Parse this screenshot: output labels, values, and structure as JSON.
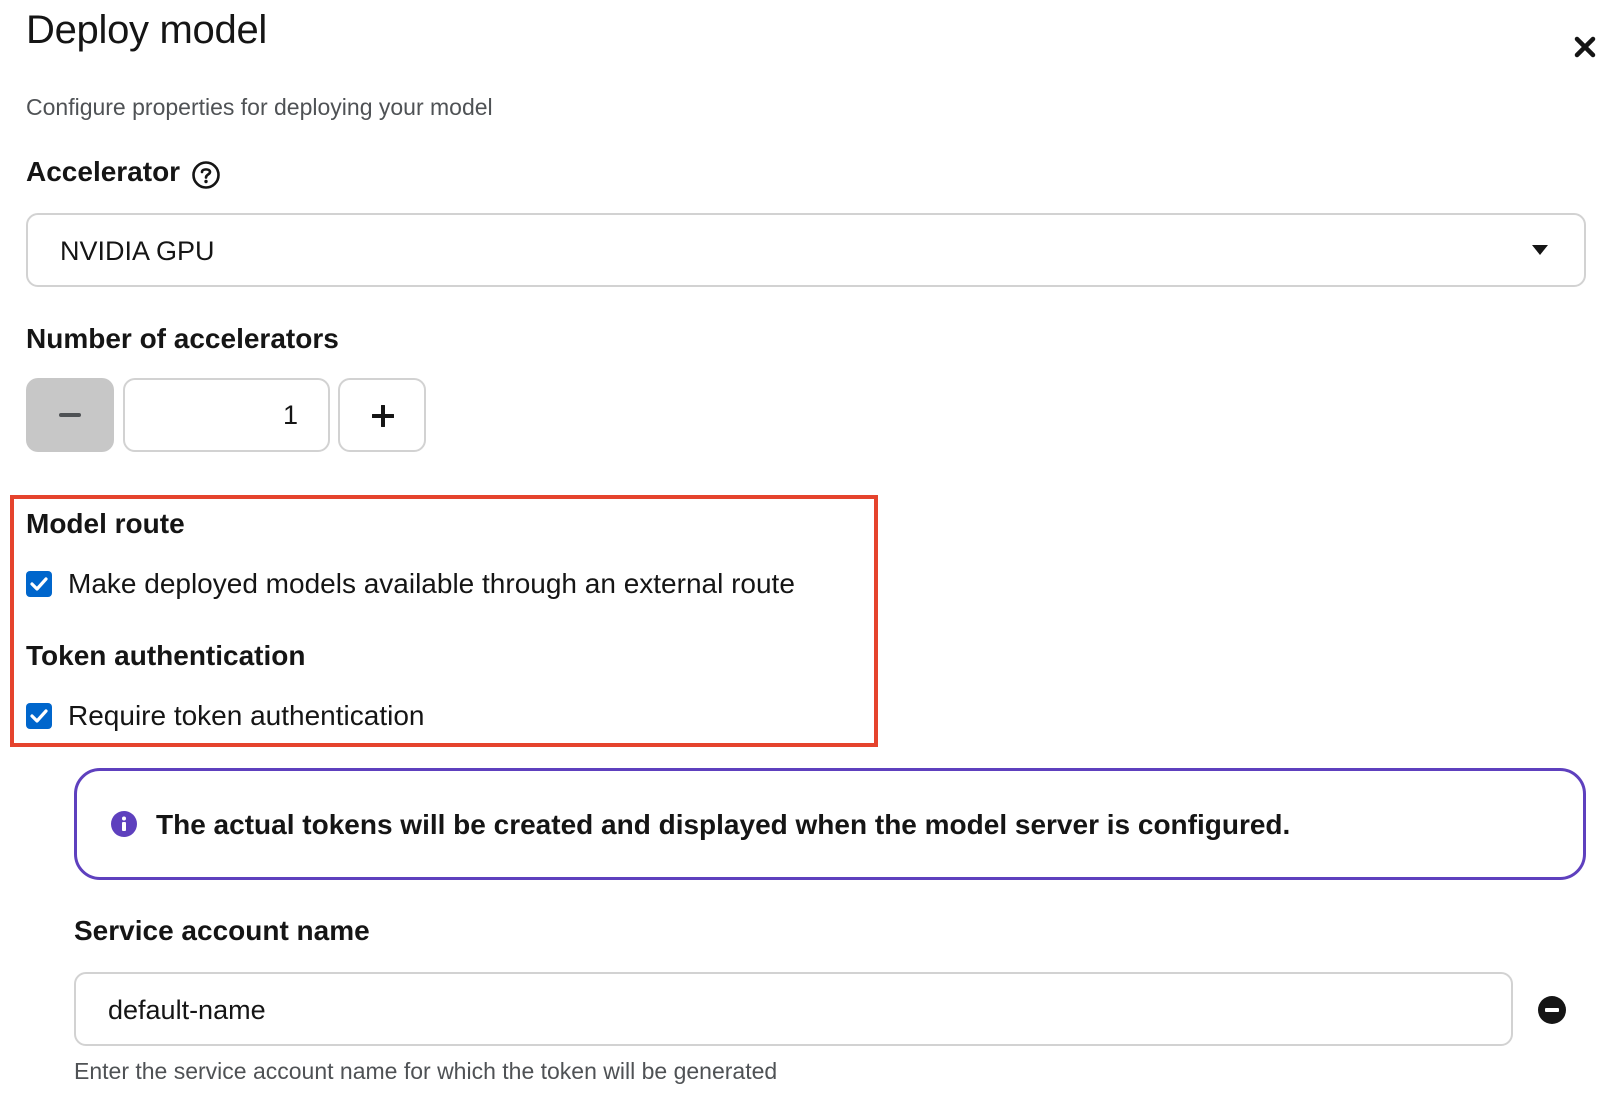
{
  "modal": {
    "title": "Deploy model",
    "subtitle": "Configure properties for deploying your model"
  },
  "accelerator": {
    "label": "Accelerator",
    "selected": "NVIDIA GPU"
  },
  "num_accelerators": {
    "label": "Number of accelerators",
    "value": "1"
  },
  "model_route": {
    "heading": "Model route",
    "checkbox_label": "Make deployed models available through an external route",
    "checked": true
  },
  "token_auth": {
    "heading": "Token authentication",
    "checkbox_label": "Require token authentication",
    "checked": true
  },
  "alert": {
    "message": "The actual tokens will be created and displayed when the model server is configured."
  },
  "service_account": {
    "label": "Service account name",
    "value": "default-name",
    "helper": "Enter the service account name for which the token will be generated"
  },
  "colors": {
    "checkbox": "#0066cc",
    "alert_border": "#5e40be",
    "highlight_border": "#e5432d"
  },
  "icons": [
    "close-icon",
    "help-icon",
    "caret-down-icon",
    "minus-icon",
    "plus-icon",
    "check-icon",
    "info-icon",
    "remove-icon"
  ]
}
